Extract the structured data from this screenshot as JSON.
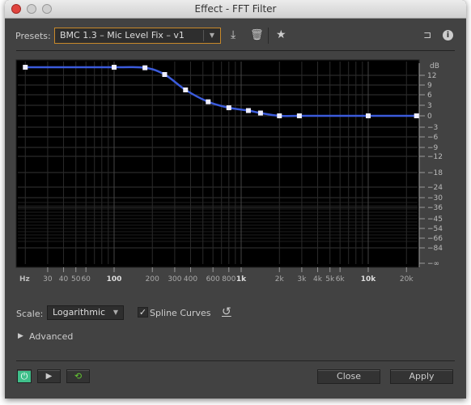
{
  "window": {
    "title": "Effect - FFT Filter"
  },
  "presets": {
    "label": "Presets:",
    "value": "BMC 1.3 – Mic Level Fix – v1"
  },
  "toolbar_icons": [
    "download-preset-icon",
    "trash-icon",
    "star-icon",
    "routing-icon",
    "info-icon"
  ],
  "chart_data": {
    "type": "line",
    "x_scale": "log",
    "xlabel": "Hz",
    "ylabel": "dB",
    "x_ticks": [
      {
        "v": 30,
        "l": "30"
      },
      {
        "v": 40,
        "l": "40"
      },
      {
        "v": 50,
        "l": "50"
      },
      {
        "v": 60,
        "l": "60"
      },
      {
        "v": 100,
        "l": "100",
        "bold": true
      },
      {
        "v": 200,
        "l": "200"
      },
      {
        "v": 300,
        "l": "300"
      },
      {
        "v": 400,
        "l": "400"
      },
      {
        "v": 600,
        "l": "600"
      },
      {
        "v": 800,
        "l": "800"
      },
      {
        "v": 1000,
        "l": "1k",
        "bold": true
      },
      {
        "v": 2000,
        "l": "2k"
      },
      {
        "v": 3000,
        "l": "3k"
      },
      {
        "v": 4000,
        "l": "4k"
      },
      {
        "v": 5000,
        "l": "5k"
      },
      {
        "v": 6000,
        "l": "6k"
      },
      {
        "v": 10000,
        "l": "10k",
        "bold": true
      },
      {
        "v": 20000,
        "l": "20k"
      }
    ],
    "y_ticks": [
      "12",
      "9",
      "6",
      "3",
      "0",
      "−3",
      "−6",
      "−9",
      "−12",
      "−18",
      "−24",
      "−30",
      "−36",
      "−45",
      "−54",
      "−66",
      "−84",
      "−∞"
    ],
    "xlim": [
      20,
      24000
    ],
    "grid": true,
    "spline": true,
    "points": [
      [
        20,
        15
      ],
      [
        100,
        15
      ],
      [
        175,
        14.8
      ],
      [
        250,
        12.3
      ],
      [
        365,
        7.5
      ],
      [
        550,
        4
      ],
      [
        800,
        2.3
      ],
      [
        1140,
        1.5
      ],
      [
        1420,
        0.8
      ],
      [
        2000,
        0
      ],
      [
        2870,
        0
      ],
      [
        10000,
        0
      ],
      [
        24000,
        0
      ]
    ],
    "line_color": "#3b5bdb"
  },
  "scale": {
    "label": "Scale:",
    "value": "Logarithmic"
  },
  "spline": {
    "label": "Spline Curves",
    "checked": true
  },
  "advanced": {
    "label": "Advanced"
  },
  "footer": {
    "close": "Close",
    "apply": "Apply"
  },
  "colors": {
    "power": "#3fbf8a",
    "accent_border": "#c8892a"
  }
}
